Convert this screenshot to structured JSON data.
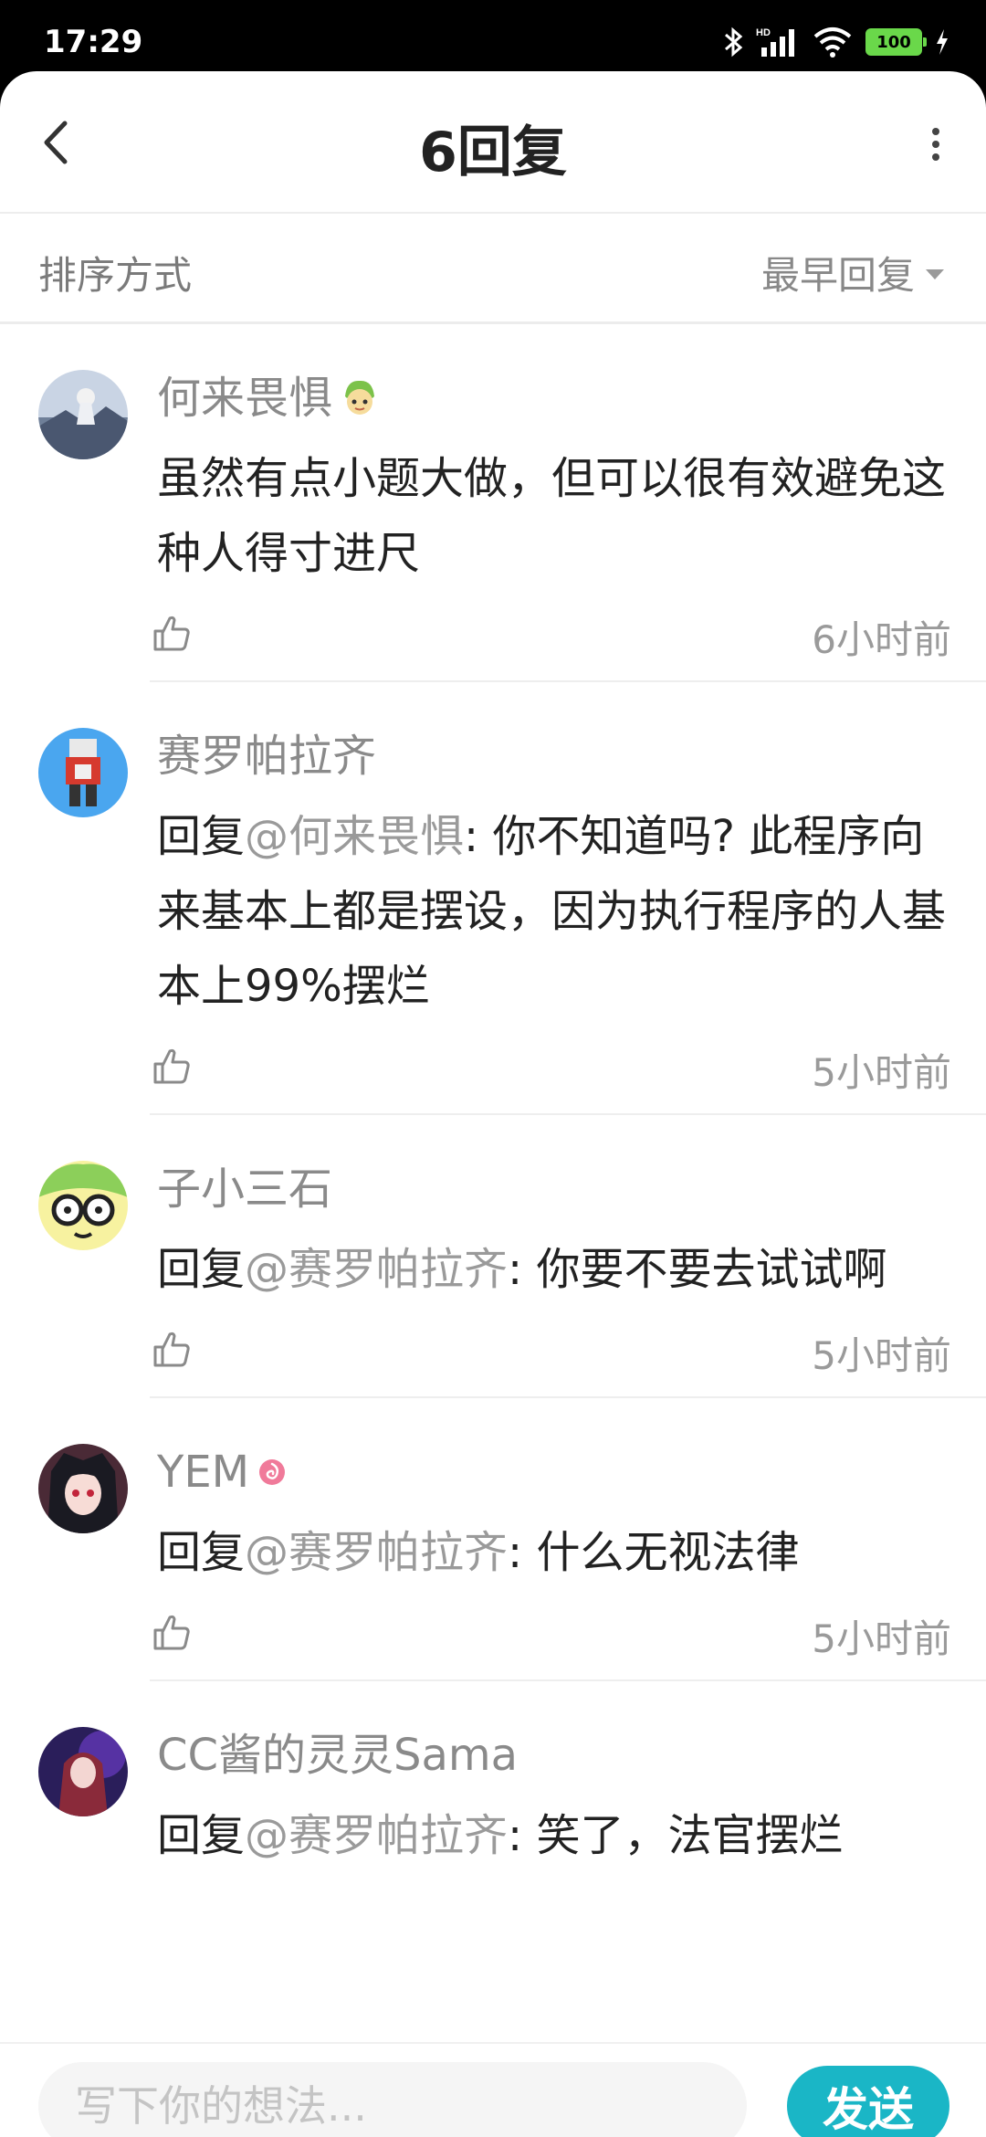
{
  "status_bar": {
    "time": "17:29",
    "network": "HD",
    "battery": "100"
  },
  "header": {
    "title": "6回复"
  },
  "sort": {
    "label": "排序方式",
    "selected": "最早回复"
  },
  "comments": [
    {
      "name": "何来畏惧",
      "badge": "green-hair-emoji-icon",
      "prefix": "",
      "mention": "",
      "text": "虽然有点小题大做，但可以很有效避免这种人得寸进尺",
      "time": "6小时前"
    },
    {
      "name": "赛罗帕拉齐",
      "badge": "",
      "prefix": "回复",
      "mention": "@何来畏惧",
      "text": ": 你不知道吗? 此程序向来基本上都是摆设，因为执行程序的人基本上99%摆烂",
      "time": "5小时前"
    },
    {
      "name": "子小三石",
      "badge": "",
      "prefix": "回复",
      "mention": "@赛罗帕拉齐",
      "text": ": 你要不要去试试啊",
      "time": "5小时前"
    },
    {
      "name": "YEM",
      "badge": "pink-swirl-badge-icon",
      "prefix": "回复",
      "mention": "@赛罗帕拉齐",
      "text": ": 什么无视法律",
      "time": "5小时前"
    },
    {
      "name": "CC酱的灵灵Sama",
      "badge": "",
      "prefix": "回复",
      "mention": "@赛罗帕拉齐",
      "text": ": 笑了，法官摆烂",
      "time": ""
    }
  ],
  "composer": {
    "placeholder": "写下你的想法...",
    "send_label": "发送"
  },
  "colors": {
    "accent": "#1ab6c6",
    "battery": "#6ad84a"
  }
}
